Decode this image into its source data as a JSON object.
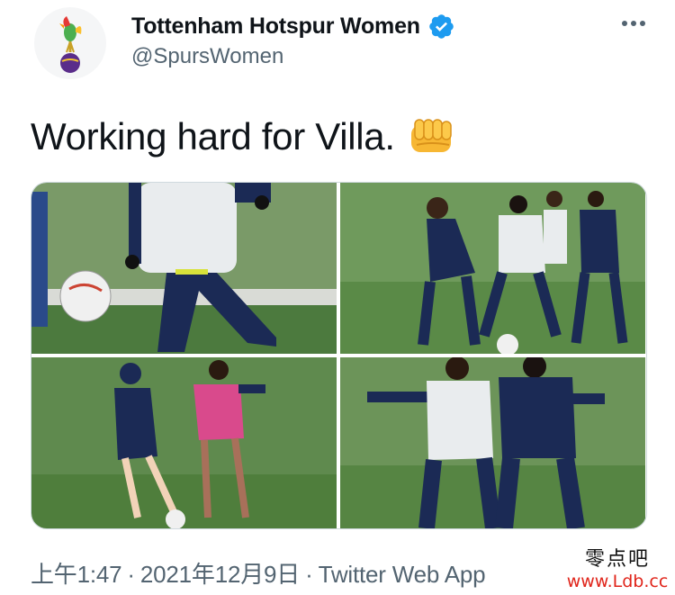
{
  "account": {
    "display_name": "Tottenham Hotspur Women",
    "handle": "@SpursWomen",
    "verified": true,
    "avatar_icon": "cockerel-on-ball-logo-icon",
    "more_icon": "more-options-icon"
  },
  "tweet": {
    "text": "Working hard for Villa.",
    "emoji_icon": "oncoming-fist-icon"
  },
  "media": [
    {
      "index": 1
    },
    {
      "index": 2
    },
    {
      "index": 3
    },
    {
      "index": 4
    }
  ],
  "meta": {
    "time": "上午1:47",
    "date": "2021年12月9日",
    "source": "Twitter Web App",
    "separator": "·"
  },
  "watermark": {
    "title": "零点吧",
    "url": "www.Ldb.cc"
  },
  "colors": {
    "text": "#0f1419",
    "secondary": "#536471",
    "verified": "#1d9bf0",
    "border": "#cfd9de",
    "watermark_url": "#e0241a"
  }
}
